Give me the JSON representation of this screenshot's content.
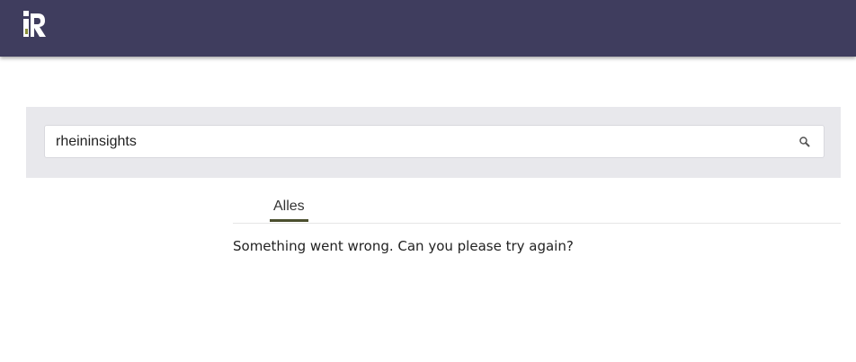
{
  "header": {
    "logo_icon": "rheininsights-logo",
    "background_color": "#3f3d5e"
  },
  "search": {
    "value": "rheininsights",
    "icon": "search-icon"
  },
  "tabs": [
    {
      "label": "Alles",
      "active": true
    }
  ],
  "result": {
    "message": "Something went wrong. Can you please try again?"
  },
  "colors": {
    "tab_underline": "#4b4f2e",
    "panel_background": "#e8e8ec"
  }
}
